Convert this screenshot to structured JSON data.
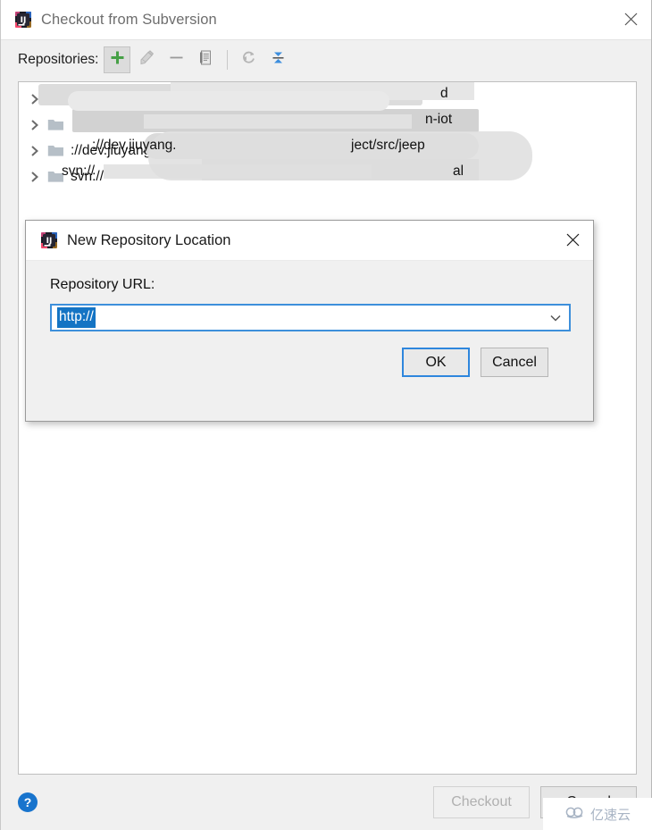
{
  "window": {
    "title": "Checkout from Subversion",
    "app_icon": "intellij-idea-icon",
    "close_icon": "close-icon"
  },
  "toolbar": {
    "label": "Repositories:",
    "buttons": [
      {
        "name": "add-repository-button",
        "icon": "plus-icon",
        "state": "selected",
        "enabled": true
      },
      {
        "name": "edit-repository-button",
        "icon": "edit-pencil-icon",
        "state": "normal",
        "enabled": false
      },
      {
        "name": "remove-repository-button",
        "icon": "minus-icon",
        "state": "normal",
        "enabled": false
      },
      {
        "name": "copy-repository-button",
        "icon": "copy-document-icon",
        "state": "normal",
        "enabled": false
      },
      {
        "name": "refresh-button",
        "icon": "refresh-icon",
        "state": "normal",
        "enabled": false
      },
      {
        "name": "collapse-all-button",
        "icon": "collapse-all-icon",
        "state": "normal",
        "enabled": true
      }
    ]
  },
  "repository_tree": {
    "rows": [
      {
        "expander": "chevron-right-icon",
        "folder": "folder-icon",
        "label": "svn://",
        "label_suffix": "d",
        "redacted": true
      },
      {
        "expander": "chevron-right-icon",
        "folder": "folder-icon",
        "label": "",
        "label_suffix": "n-iot",
        "redacted": true
      },
      {
        "expander": "chevron-right-icon",
        "folder": "folder-icon",
        "label": "://dev.jiuyang.",
        "label_suffix": "ject/src/jeep",
        "redacted": true
      },
      {
        "expander": "chevron-right-icon",
        "folder": "folder-icon",
        "label": "svn://",
        "label_suffix": "al",
        "redacted": true
      }
    ]
  },
  "bottom_bar": {
    "help_icon": "question-mark-icon",
    "help_glyph": "?",
    "checkout_label": "Checkout",
    "checkout_enabled": false,
    "cancel_label": "Cancel",
    "cancel_enabled": true
  },
  "modal": {
    "title": "New Repository Location",
    "app_icon": "intellij-idea-icon",
    "close_icon": "close-icon",
    "url_label": "Repository URL:",
    "url_value": "http://",
    "url_selected": true,
    "dropdown_icon": "chevron-down-icon",
    "ok_label": "OK",
    "cancel_label": "Cancel",
    "focused_button": "OK"
  },
  "watermark": {
    "text": "亿速云",
    "icon": "cloud-icon"
  },
  "colors": {
    "accent_blue": "#1474c4",
    "focus_border": "#2e86dd",
    "window_bg": "#f0f0f0",
    "panel_bg": "#ffffff",
    "help_blue": "#1874cd",
    "plus_green": "#4caf50"
  }
}
